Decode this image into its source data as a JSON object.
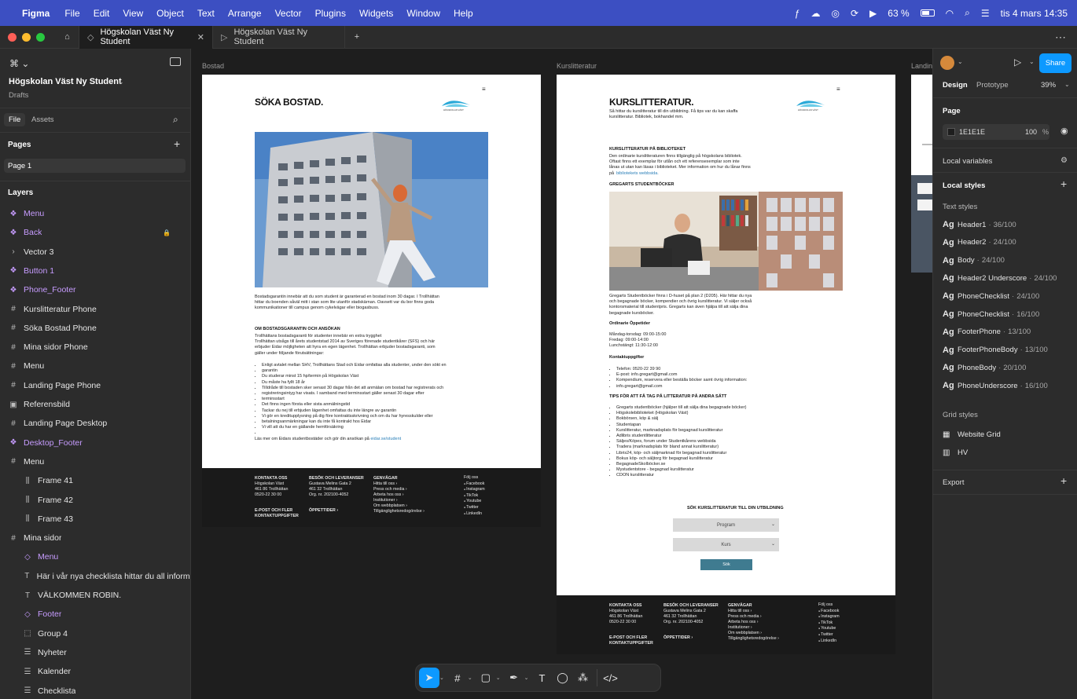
{
  "menubar": {
    "app_name": "Figma",
    "items": [
      "File",
      "Edit",
      "View",
      "Object",
      "Text",
      "Arrange",
      "Vector",
      "Plugins",
      "Widgets",
      "Window",
      "Help"
    ],
    "battery": "63 %",
    "datetime": "tis 4 mars 14:35"
  },
  "tabs": [
    {
      "label": "Högskolan Väst Ny Student",
      "active": true
    },
    {
      "label": "Högskolan Väst Ny Student",
      "active": false
    }
  ],
  "left_panel": {
    "file_title": "Högskolan Väst Ny Student",
    "file_subtitle": "Drafts",
    "tab_file": "File",
    "tab_assets": "Assets",
    "pages_heading": "Pages",
    "pages": [
      "Page 1"
    ],
    "layers_heading": "Layers",
    "layers": [
      {
        "label": "Menu",
        "icon": "component-icon"
      },
      {
        "label": "Back",
        "icon": "component-icon"
      },
      {
        "label": "Vector 3",
        "icon": "chevron-icon"
      },
      {
        "label": "Button 1",
        "icon": "component-icon"
      },
      {
        "label": "Phone_Footer",
        "icon": "component-icon"
      },
      {
        "label": "Kurslitteratur Phone",
        "icon": "frame-icon"
      },
      {
        "label": "Söka Bostad Phone",
        "icon": "frame-icon"
      },
      {
        "label": "Mina sidor Phone",
        "icon": "frame-icon"
      },
      {
        "label": "Menu",
        "icon": "frame-icon"
      },
      {
        "label": "Landing Page Phone",
        "icon": "frame-icon"
      },
      {
        "label": "Referensbild",
        "icon": "image-icon"
      },
      {
        "label": "Landing Page Desktop",
        "icon": "frame-icon"
      },
      {
        "label": "Desktop_Footer",
        "icon": "component-icon"
      },
      {
        "label": "Menu",
        "icon": "frame-icon"
      },
      {
        "label": "Frame 41",
        "icon": "autolayout-icon"
      },
      {
        "label": "Frame 42",
        "icon": "autolayout-icon"
      },
      {
        "label": "Frame 43",
        "icon": "autolayout-icon"
      },
      {
        "label": "Mina sidor",
        "icon": "frame-icon"
      },
      {
        "label": "Menu",
        "icon": "instance-icon"
      },
      {
        "label": "Här i vår nya checklista hittar du all information d",
        "icon": "text-icon"
      },
      {
        "label": "VÄLKOMMEN ROBIN.",
        "icon": "text-icon"
      },
      {
        "label": "Footer",
        "icon": "instance-icon"
      },
      {
        "label": "Group 4",
        "icon": "group-icon"
      },
      {
        "label": "Nyheter",
        "icon": "list-icon"
      },
      {
        "label": "Kalender",
        "icon": "list-icon"
      },
      {
        "label": "Checklista",
        "icon": "list-icon"
      }
    ]
  },
  "right_panel": {
    "tab_design": "Design",
    "tab_prototype": "Prototype",
    "zoom": "39%",
    "share": "Share",
    "page_heading": "Page",
    "page_color": "1E1E1E",
    "page_opacity": "100",
    "percent": "%",
    "local_variables": "Local variables",
    "local_styles": "Local styles",
    "text_styles_heading": "Text styles",
    "text_styles": [
      {
        "name": "Header1",
        "spec": "36/100"
      },
      {
        "name": "Header2",
        "spec": "24/100"
      },
      {
        "name": "Body",
        "spec": "24/100"
      },
      {
        "name": "Header2 Underscore",
        "spec": "24/100"
      },
      {
        "name": "PhoneChecklist",
        "spec": "24/100"
      },
      {
        "name": "PhoneChecklist",
        "spec": "16/100"
      },
      {
        "name": "FooterPhone",
        "spec": "13/100"
      },
      {
        "name": "FooterPhoneBody",
        "spec": "13/100"
      },
      {
        "name": "PhoneBody",
        "spec": "20/100"
      },
      {
        "name": "PhoneUnderscore",
        "spec": "16/100"
      }
    ],
    "grid_styles_heading": "Grid styles",
    "grid_styles": [
      "Website Grid",
      "HV"
    ],
    "export": "Export"
  },
  "canvas": {
    "frame_labels": [
      "Bostad",
      "Kurslitteratur",
      "Landin"
    ],
    "bostad": {
      "title": "SÖKA BOSTAD.",
      "logo_text": "HÖGSKOLAN VÄST",
      "intro": [
        "Bostadsgarantin innebär att du som student är garanterad en bostad inom 30 dagar. I Trollhättan",
        "hittar du boenden såväl mitt i stan som lite utanför stadskärnan. Oavsett var du bor finns goda",
        "kommunikationer till campus genom cykelvägar eller biogasbuss."
      ],
      "subheading": "OM BOSTADSGARANTIN OCH ANSÖKAN",
      "body": [
        "Trollhättans bostadsgaranti för studenter innebär en extra trygghet",
        "Trollhättan utsågs till årets studentstad 2014 av Sveriges förenade studentkårer (SFS) och här",
        "erbjuder Eidar möjligheten att hyra en egen lägenhet. Trollhättan erbjuder bostadsgaranti, som",
        "gäller under följande förutsättningar:"
      ],
      "bullets": [
        "Enligt avtalet mellan SHV, Trollhättans Stad och Eidar omfattas alla studenter, under den sökt en",
        "garantin",
        "Du studerar minst 15 hp/termin på Högskolan Väst",
        "Du måste ha fyllt 18 år",
        "Tilldråde till bostaden sker senast 30 dagar från det att anmälan om bostad har registrerats och",
        "registreringsintyg har visats. I samband med terminsstart gäller senast 30 dagar efter",
        "terminsstart",
        "Det finns ingen första eller sista anmälningstid",
        "Tackar du nej till erbjuden lägenhet omfattas du inte längre av garantin",
        "Vi gör en kreditupplysning på dig före kontraktsskrivning och om du har hyresskulder eller",
        "betalningsanmärkningar kan du inte få kontrakt hos Eidar",
        "Vi vill att du har en gällande hemförsäkring",
        ""
      ],
      "outro": "Läs mer om Eidars studentbostäder och gör din ansökan på",
      "outro_link": "eidar.se/student"
    },
    "kurs": {
      "title": "KURSLITTERATUR.",
      "logo_text": "HÖGSKOLAN VÄST",
      "intro": [
        "Så hittar du kurslitteratur till din utbildning. Få tips var du kan skaffa",
        "kurslitteratur. Bibliotek, bokhandel mm."
      ],
      "sub1": "KURSLITTERATUR PÅ BIBLIOTEKET",
      "bib": [
        "Den ordinarie kurslitteraturen finns tillgänglig på högskolans bibliotek.",
        "Oftast finns ett exemplar för utlån och ett referensexemplar som inte",
        "lånas ut utan kan läsas i biblioteket. Mer information om hur du lånar finns",
        "på"
      ],
      "bib_link": "bibliotekets webbsida.",
      "sub2": "GREGARTS STUDENTBÖCKER",
      "greg": [
        "Gregarts Studentböcker finns i D-huset på plan 2 (D205). Här hittar du nya",
        "och begagnade böcker, kompendier och övrig kurslitteratur. Vi säljer också",
        "kontorsmaterial till studentpris. Gregarts kan även hjälpa till att sälja dina",
        "begagnade kursböcker."
      ],
      "hours_heading": "Ordinarie Öppetider",
      "hours": [
        "Måndag-torsdag: 09:00-15:00",
        "Fredag: 09:00-14:00",
        "Lunchstängt: 11:30-12:00"
      ],
      "contact_heading": "Kontaktuppgifter",
      "contact": [
        "Telefon: 0520-22 39 90",
        "E-post: info.gregart@gmail.com",
        "Kompendium, reservera eller beställa böcker samt övrig information:",
        "info.gregart@gmail.com"
      ],
      "sub3": "TIPS FÖR ATT FÅ TAG PÅ LITTERATUR PÅ ANDRA SÄTT",
      "tips": [
        "Gregarts studentböcker (hjälper till att sälja dina begagnade böcker)",
        "Högskolebiblioteket (Högskolan Väst)",
        "Bokbörsen, köp & sälj",
        "Studentapan",
        "Kurslitteratur, marknadsplats för begagnad kurslitteratur",
        "Adlibris studentlitteratur",
        "Säljes/Köpes, forum under Studentkårens webbsida",
        "Tradera (marknadsplats för bland annat kurslitteratur)",
        "Libris24, köp- och säljmarknad för begagnad kurslitteratur",
        "Bokus köp- och säljtorg för begagnad kurslitteratur",
        "BegagnadeSkolböcker.se",
        "Mystudentstore - begagnad kurslitteratur",
        "CDON kurslitteratur"
      ],
      "search_heading": "SÖK KURSLITTERATUR TILL DIN UTBILDNING",
      "select_program": "Program",
      "select_kurs": "Kurs",
      "search_button": "Sök"
    },
    "footer": {
      "col1_title": "KONTAKTA OSS",
      "col1": [
        "Högskolan Väst",
        "461 86 Trollhättan",
        "0520-22 30 00"
      ],
      "col1_b": [
        "E-POST OCH FLER",
        "KONTAKTUPPGIFTER"
      ],
      "col2_title": "BESÖK OCH LEVERANSER",
      "col2": [
        "Gustava Melins Gata 2",
        "461 32 Trollhättan",
        "Org. nr. 202100-4052"
      ],
      "col2_b": "ÖPPETTIDER ›",
      "col3_title": "GENVÄGAR",
      "col3": [
        "Hitta till oss ›",
        "Press och media ›",
        "Arbeta hos oss ›",
        "Institutioner ›",
        "Om webbplatsen ›",
        "Tillgänglighetsredogörelse ›"
      ],
      "col4_title": "Följ oss",
      "col4": [
        "Facebook",
        "Instagram",
        "TikTok",
        "Youtube",
        "Twitter",
        "LinkedIn"
      ]
    }
  }
}
